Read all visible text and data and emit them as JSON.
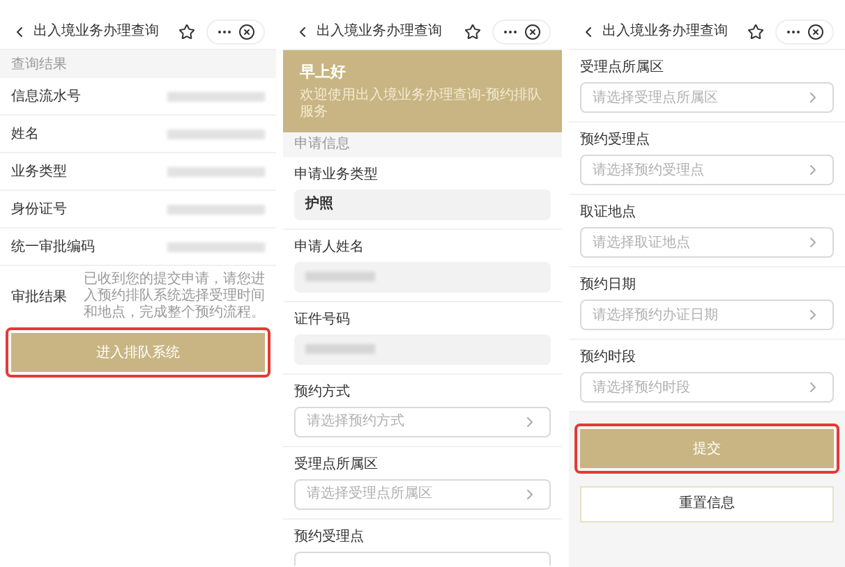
{
  "query_result_screen": {
    "header": {
      "title": "出入境业务办理查询"
    },
    "section": "查询结果",
    "rows": [
      {
        "label": "信息流水号"
      },
      {
        "label": "姓名"
      },
      {
        "label": "业务类型"
      },
      {
        "label": "身份证号"
      },
      {
        "label": "统一审批编码"
      }
    ],
    "result": {
      "label": "审批结果",
      "text": "已收到您的提交申请，请您进入预约排队系统选择受理时间和地点，完成整个预约流程。"
    },
    "button": {
      "label": "进入排队系统",
      "highlighted": true
    }
  },
  "application_screen": {
    "header": {
      "title": "出入境业务办理查询"
    },
    "banner": {
      "greeting": "早上好",
      "subtitle": "欢迎使用出入境业务办理查询-预约排队服务"
    },
    "section": "申请信息",
    "fields": [
      {
        "kind": "filled",
        "label": "申请业务类型",
        "value": "护照"
      },
      {
        "kind": "blurred",
        "label": "申请人姓名"
      },
      {
        "kind": "blurred",
        "label": "证件号码"
      },
      {
        "kind": "select",
        "label": "预约方式",
        "placeholder": "请选择预约方式"
      },
      {
        "kind": "select",
        "label": "受理点所属区",
        "placeholder": "请选择受理点所属区"
      },
      {
        "kind": "cut",
        "label": "预约受理点"
      }
    ]
  },
  "appointment_screen": {
    "header": {
      "title": "出入境业务办理查询"
    },
    "fields": [
      {
        "kind": "select",
        "label": "受理点所属区",
        "placeholder": "请选择受理点所属区"
      },
      {
        "kind": "select",
        "label": "预约受理点",
        "placeholder": "请选择预约受理点"
      },
      {
        "kind": "select",
        "label": "取证地点",
        "placeholder": "请选择取证地点"
      },
      {
        "kind": "select",
        "label": "预约日期",
        "placeholder": "请选择预约办证日期"
      },
      {
        "kind": "select",
        "label": "预约时段",
        "placeholder": "请选择预约时段"
      }
    ],
    "submit_button": {
      "label": "提交",
      "highlighted": true
    },
    "reset_button": {
      "label": "重置信息"
    }
  }
}
